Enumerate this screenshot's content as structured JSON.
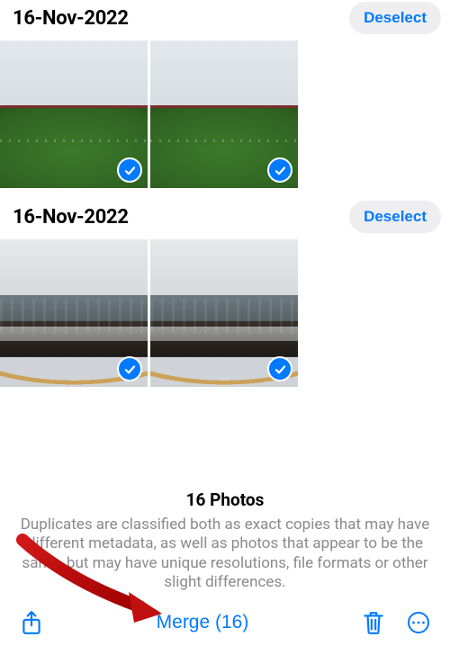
{
  "groups": [
    {
      "date_label": "16-Nov-2022",
      "deselect_label": "Deselect",
      "thumbs": [
        {
          "selected": true,
          "scene": "scene-field"
        },
        {
          "selected": true,
          "scene": "scene-field"
        }
      ]
    },
    {
      "date_label": "16-Nov-2022",
      "deselect_label": "Deselect",
      "thumbs": [
        {
          "selected": true,
          "scene": "scene-arena"
        },
        {
          "selected": true,
          "scene": "scene-arena"
        }
      ]
    }
  ],
  "footer": {
    "count_label": "16 Photos",
    "explainer": "Duplicates are classified both as exact copies that may have different metadata, as well as photos that appear to be the same, but may have unique resolutions, file formats or other slight differences."
  },
  "toolbar": {
    "share_icon": "share-icon",
    "merge_label": "Merge (16)",
    "trash_icon": "trash-icon",
    "more_icon": "more-icon"
  },
  "colors": {
    "accent": "#007aff",
    "pill_bg": "#eeeef0",
    "secondary_text": "#8a8a8e"
  },
  "annotation": {
    "arrow_target": "merge-button"
  }
}
